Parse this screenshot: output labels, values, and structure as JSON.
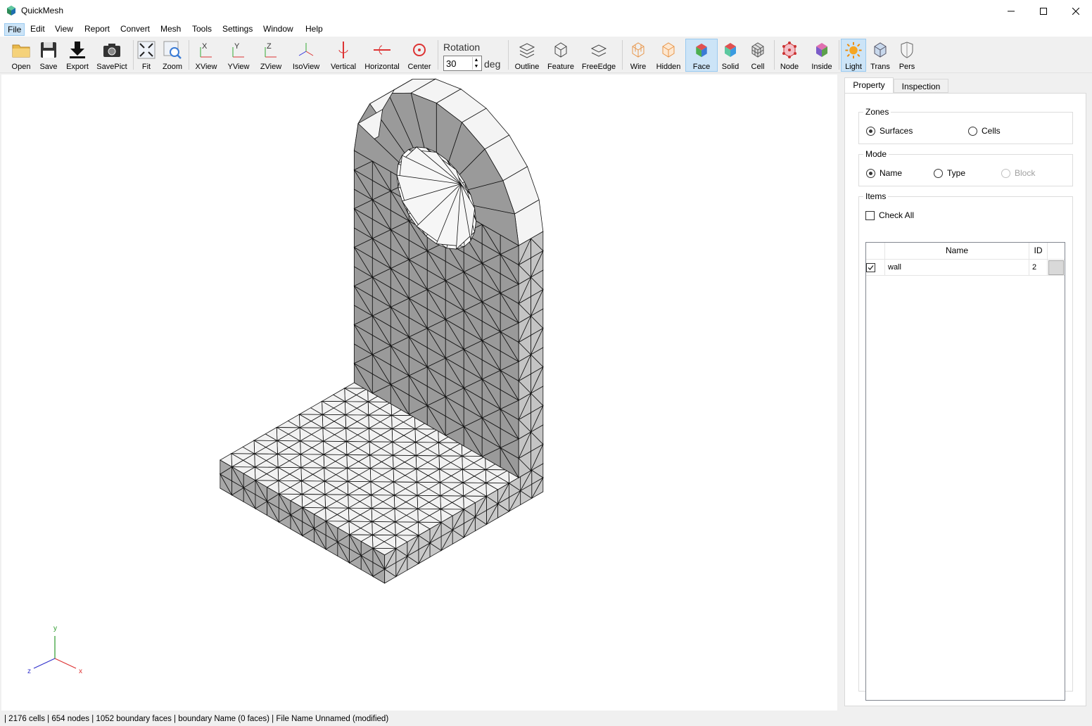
{
  "window": {
    "title": "QuickMesh"
  },
  "menu": [
    "File",
    "Edit",
    "View",
    "Report",
    "Convert",
    "Mesh",
    "Tools",
    "Settings",
    "Window",
    "Help"
  ],
  "toolbar": {
    "open": "Open",
    "save": "Save",
    "export": "Export",
    "savepict": "SavePict",
    "fit": "Fit",
    "zoom": "Zoom",
    "xview": "XView",
    "yview": "YView",
    "zview": "ZView",
    "isoview": "IsoView",
    "vertical": "Vertical",
    "horizontal": "Horizontal",
    "center": "Center",
    "rotation_label": "Rotation",
    "rotation_value": "30",
    "rotation_unit": "deg",
    "outline": "Outline",
    "feature": "Feature",
    "freeedge": "FreeEdge",
    "wire": "Wire",
    "hidden": "Hidden",
    "face": "Face",
    "solid": "Solid",
    "cell": "Cell",
    "node": "Node",
    "inside": "Inside",
    "light": "Light",
    "trans": "Trans",
    "pers": "Pers"
  },
  "axis_triad": {
    "y": "y",
    "z": "z",
    "x": "x"
  },
  "panel": {
    "tabs": [
      "Property",
      "Inspection"
    ],
    "zones": {
      "title": "Zones",
      "surfaces": "Surfaces",
      "cells": "Cells",
      "selected": "Surfaces"
    },
    "mode": {
      "title": "Mode",
      "name": "Name",
      "type": "Type",
      "block": "Block",
      "selected": "Name"
    },
    "items": {
      "title": "Items",
      "check_all": "Check All",
      "columns": {
        "name": "Name",
        "id": "ID"
      },
      "rows": [
        {
          "checked": true,
          "name": "wall",
          "id": "2"
        }
      ]
    }
  },
  "status": "| 2176 cells | 654 nodes | 1052 boundary faces |  boundary Name  (0 faces) | File Name Unnamed (modified)"
}
